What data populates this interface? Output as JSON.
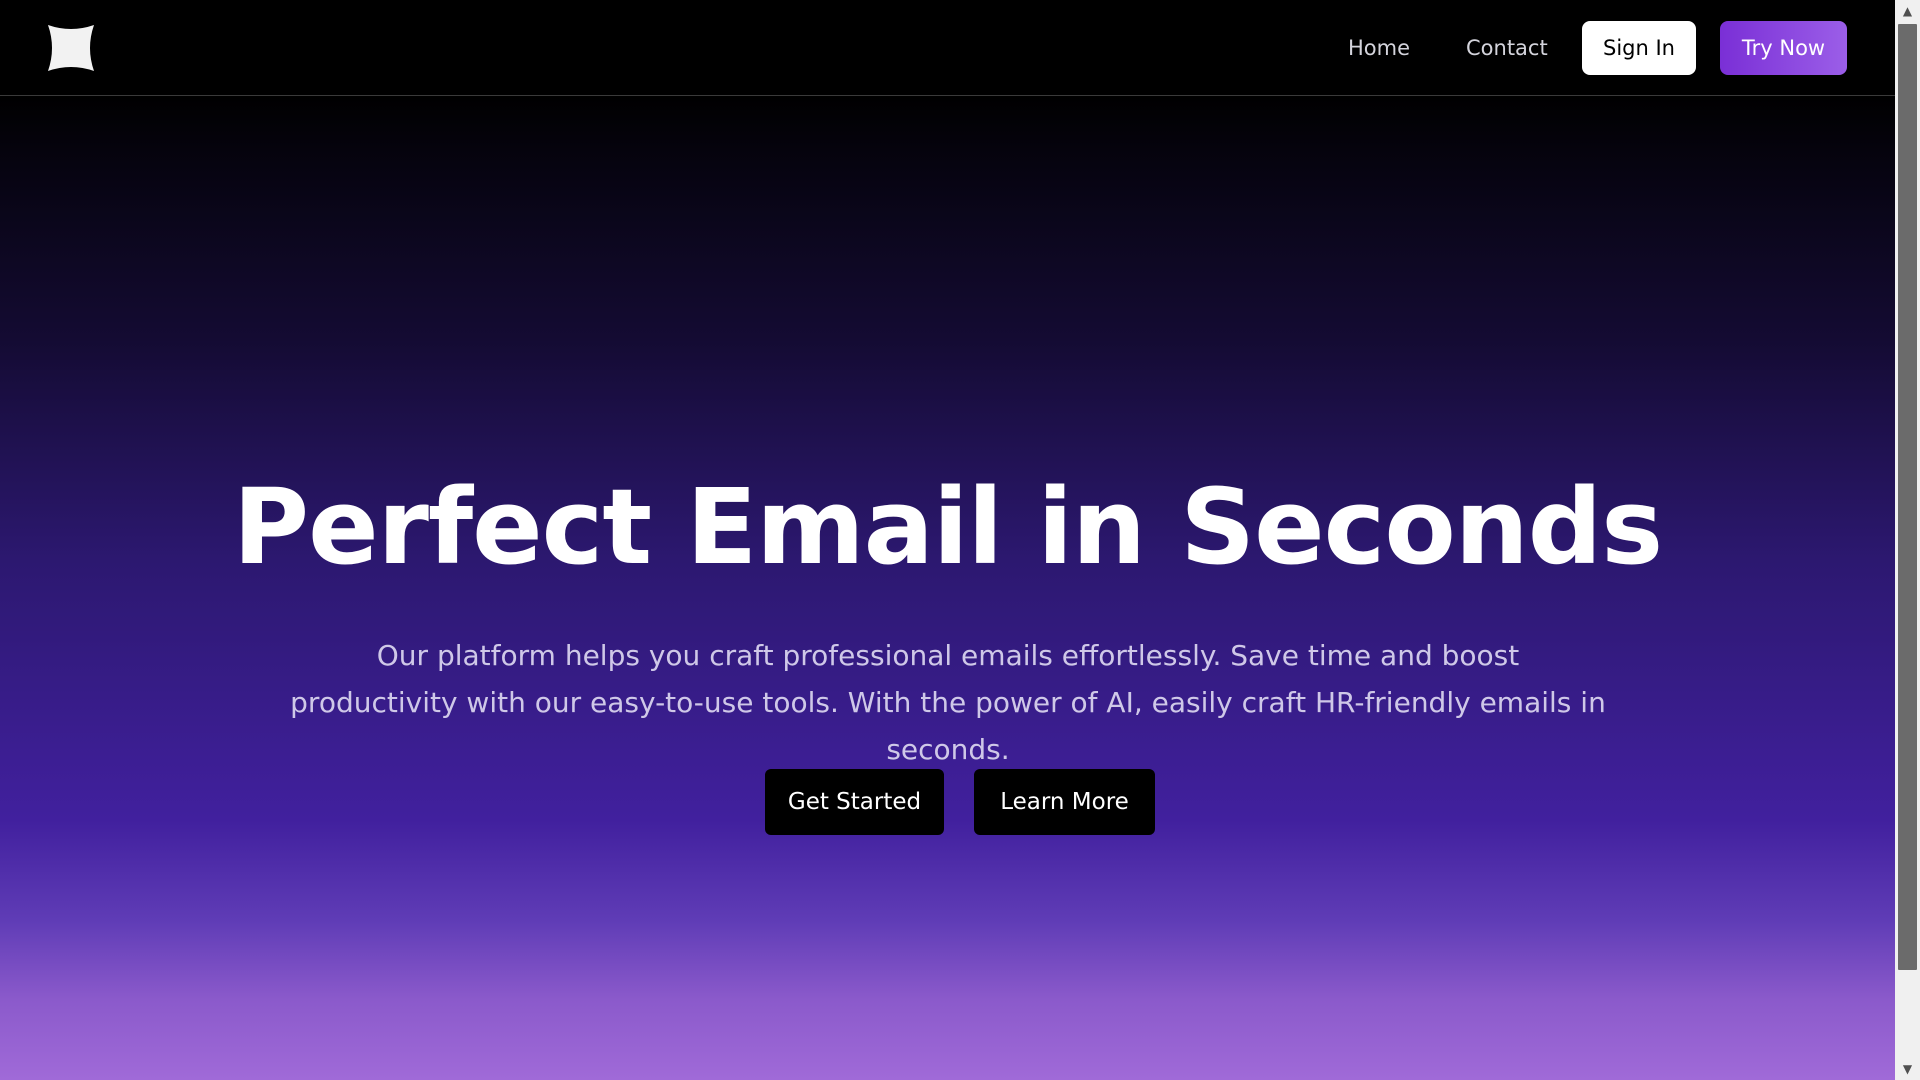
{
  "nav": {
    "logo_icon": "sparkle-star-icon",
    "home": "Home",
    "contact": "Contact",
    "sign_in": "Sign In",
    "try_now": "Try Now"
  },
  "hero": {
    "title": "Perfect Email in Seconds",
    "subtitle": "Our platform helps you craft professional emails effortlessly. Save time and boost productivity with our easy-to-use tools. With the power of AI, easily craft HR-friendly emails in seconds.",
    "get_started": "Get Started",
    "learn_more": "Learn More"
  },
  "colors": {
    "accent": "#7a2fd6",
    "background_top": "#000000",
    "background_bottom": "#a06ad8"
  }
}
